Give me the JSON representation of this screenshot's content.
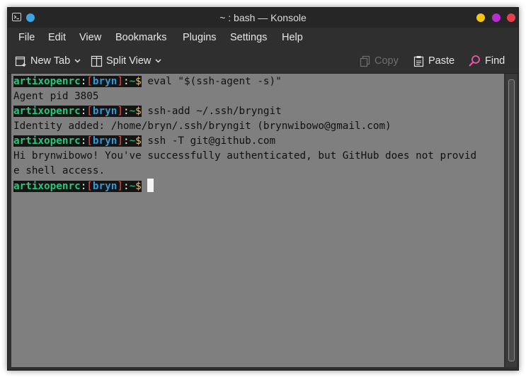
{
  "window": {
    "title": "~ : bash — Konsole"
  },
  "menu": [
    "File",
    "Edit",
    "View",
    "Bookmarks",
    "Plugins",
    "Settings",
    "Help"
  ],
  "toolbar": {
    "new_tab": "New Tab",
    "split_view": "Split View",
    "copy": "Copy",
    "paste": "Paste",
    "find": "Find"
  },
  "prompt": {
    "user": "artixopenrc",
    "colon": ":",
    "open": "[",
    "name": "bryn",
    "close": "]",
    "sep": ":",
    "dir": "~",
    "dollar": "$"
  },
  "terminal": {
    "cmd1": " eval \"$(ssh-agent -s)\"",
    "out1": "Agent pid 3805",
    "cmd2": " ssh-add ~/.ssh/bryngit",
    "out2": "Identity added: /home/bryn/.ssh/bryngit (brynwibowo@gmail.com)",
    "cmd3": " ssh -T git@github.com",
    "out3a": "Hi brynwibowo! You've successfully authenticated, but GitHub does not provid",
    "out3b": "e shell access.",
    "cmd4": " "
  },
  "colors": {
    "terminal_bg": "#7f7f7f",
    "prompt_user": "#27c77c",
    "prompt_name": "#2f9bd8",
    "prompt_bracket": "#e0574f",
    "btn_minimize": "#f5c518",
    "btn_maximize": "#b82ed1",
    "btn_close": "#e8404b"
  }
}
